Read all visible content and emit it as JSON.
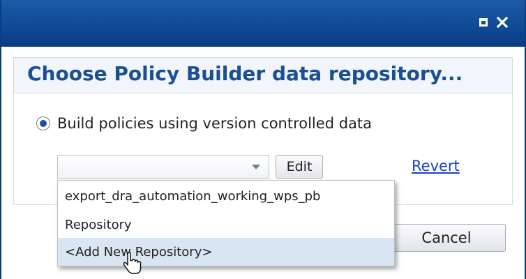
{
  "window": {
    "maximize_icon": "maximize-icon",
    "close_icon": "close-icon"
  },
  "dialog": {
    "title": "Choose Policy Builder data repository..."
  },
  "option": {
    "label": "Build policies using version controlled data",
    "selected": true
  },
  "repository_select": {
    "value": "",
    "placeholder": ""
  },
  "buttons": {
    "edit": "Edit",
    "revert": "Revert",
    "cancel": "Cancel"
  },
  "dropdown": {
    "items": [
      {
        "label": "export_dra_automation_working_wps_pb"
      },
      {
        "label": "Repository"
      },
      {
        "label": "<Add New Repository>",
        "highlighted": true
      }
    ]
  },
  "colors": {
    "titlebar": "#0d4690",
    "title_text": "#1b4f93",
    "link": "#1a3fcc",
    "highlight": "#d9e5f3"
  }
}
